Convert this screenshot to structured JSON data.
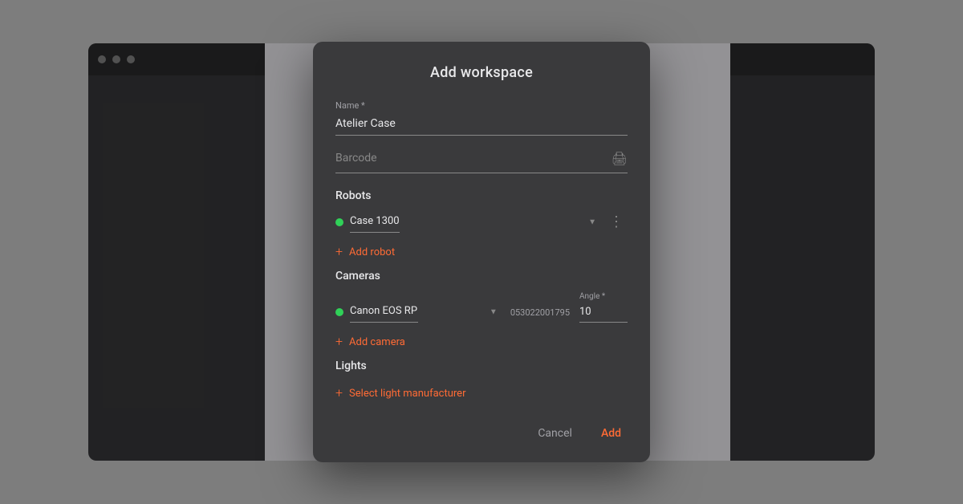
{
  "background": {
    "app_bg": "#e8e8ea",
    "sidebar_bg": "#3a3a3c",
    "main_bg": "#f0eff4"
  },
  "dialog": {
    "title": "Add workspace",
    "name_label": "Name *",
    "name_value": "Atelier Case",
    "barcode_placeholder": "Barcode",
    "barcode_icon": "🖨",
    "robots_section": "Robots",
    "robot_name": "Case 1300",
    "add_robot_label": "Add robot",
    "cameras_section": "Cameras",
    "camera_name": "Canon EOS RP",
    "camera_serial": "053022001795",
    "angle_label": "Angle *",
    "angle_value": "10",
    "add_camera_label": "Add camera",
    "lights_section": "Lights",
    "select_light_label": "Select light manufacturer",
    "cancel_label": "Cancel",
    "add_label": "Add"
  }
}
